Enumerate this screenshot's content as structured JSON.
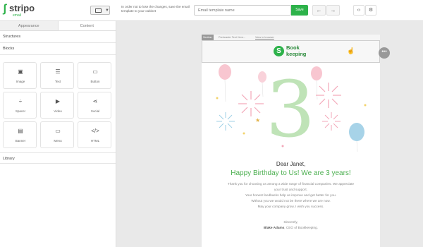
{
  "app": {
    "logo_name": "stripo",
    "logo_sub": "email",
    "hint": "In order not to lose the changes, save the email template to your cabinet",
    "email_placeholder": "Email template name",
    "save_label": "Save",
    "undo_icon": "undo-icon",
    "redo_icon": "redo-icon",
    "code_icon": "code-icon",
    "settings_icon": "gear-icon",
    "accent_color": "#2db24a"
  },
  "sidebar": {
    "tabs": [
      {
        "label": "Appearance",
        "active": true
      },
      {
        "label": "Content",
        "active": false
      }
    ],
    "structures_label": "Structures",
    "blocks_label": "Blocks",
    "library_label": "Library",
    "blocks": [
      {
        "label": "Image",
        "icon": "image-icon"
      },
      {
        "label": "Text",
        "icon": "text-icon"
      },
      {
        "label": "Button",
        "icon": "button-icon"
      },
      {
        "label": "Spacer",
        "icon": "spacer-icon"
      },
      {
        "label": "Video",
        "icon": "video-icon"
      },
      {
        "label": "Social",
        "icon": "share-icon"
      },
      {
        "label": "Banner",
        "icon": "banner-icon"
      },
      {
        "label": "Menu",
        "icon": "menu-icon"
      },
      {
        "label": "HTML",
        "icon": "html-icon"
      }
    ]
  },
  "email": {
    "section_label": "Section",
    "preheader": "Preheader Text Here...",
    "view_in_browser": "View in browser",
    "brand_line1": "Book",
    "brand_line2": "keeping",
    "more_icon": "more-icon",
    "hero_number": "3",
    "greeting": "Dear Janet,",
    "headline": "Happy Birthday to Us! We are 3 years!",
    "paragraph_lines": [
      "Thank you for choosing us among a wide range of financial companies. We appreciate",
      "your trust and support.",
      "Your honest feedbacks help us improve and get better for you.",
      "Without you we would not be there where we are now.",
      "May your company grow, I wish you success."
    ],
    "signoff": "Sincerely,",
    "signature_name": "Blake Adams",
    "signature_rest": ", CEO of Bookkeeping."
  }
}
